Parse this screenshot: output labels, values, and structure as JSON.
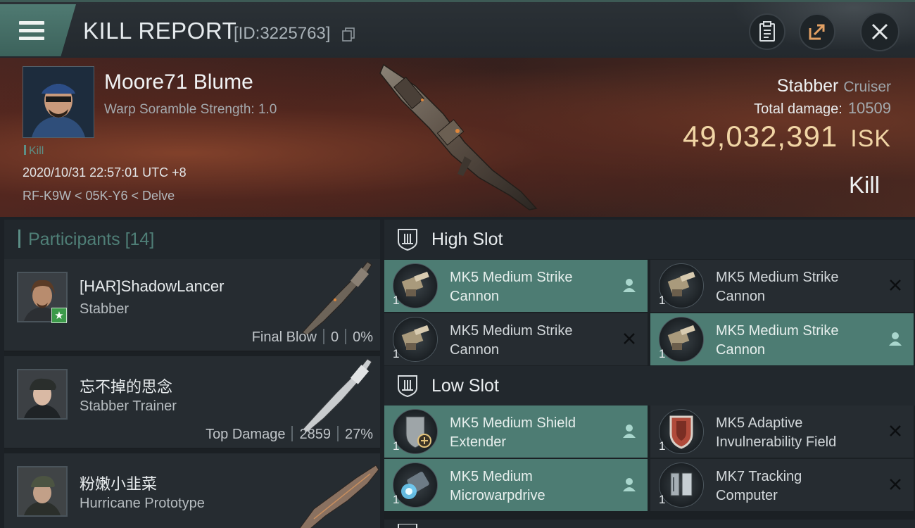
{
  "header": {
    "title": "KILL REPORT",
    "report_id": "[ID:3225763]",
    "icons": [
      "menu-icon",
      "copy-icon",
      "clipboard-icon",
      "share-icon",
      "close-icon"
    ]
  },
  "victim": {
    "name": "Moore71 Blume",
    "warp_scramble": "Warp Soramble Strength: 1.0",
    "tag": "Kill",
    "datetime": "2020/10/31 22:57:01 UTC +8",
    "location": "RF-K9W < 05K-Y6 < Delve",
    "ship": "Stabber",
    "ship_class": "Cruiser",
    "total_damage_label": "Total damage:",
    "total_damage": "10509",
    "isk_value": "49,032,391",
    "isk_unit": "ISK",
    "result": "Kill"
  },
  "participants": {
    "title": "Participants",
    "count": "[14]",
    "rows": [
      {
        "name": "[HAR]ShadowLancer",
        "ship": "Stabber",
        "stat_label": "Final Blow",
        "damage": "0",
        "percent": "0%"
      },
      {
        "name": "忘不掉的思念",
        "ship": "Stabber Trainer",
        "stat_label": "Top Damage",
        "damage": "2859",
        "percent": "27%"
      },
      {
        "name": "粉嫩小韭菜",
        "ship": "Hurricane Prototype",
        "stat_label": "",
        "damage": "",
        "percent": ""
      }
    ]
  },
  "slots": {
    "high": {
      "label": "High Slot",
      "modules": [
        {
          "qty": "1",
          "line1": "MK5 Medium Strike",
          "line2": "Cannon",
          "status": "dropped"
        },
        {
          "qty": "1",
          "line1": "MK5 Medium Strike",
          "line2": "Cannon",
          "status": "destroyed"
        },
        {
          "qty": "1",
          "line1": "MK5 Medium Strike",
          "line2": "Cannon",
          "status": "destroyed"
        },
        {
          "qty": "1",
          "line1": "MK5 Medium Strike",
          "line2": "Cannon",
          "status": "dropped"
        }
      ]
    },
    "low": {
      "label": "Low Slot",
      "modules": [
        {
          "qty": "1",
          "line1": "MK5 Medium Shield",
          "line2": "Extender",
          "status": "dropped"
        },
        {
          "qty": "1",
          "line1": "MK5 Adaptive",
          "line2": "Invulnerability Field",
          "status": "destroyed"
        },
        {
          "qty": "1",
          "line1": "MK5 Medium",
          "line2": "Microwarpdrive",
          "status": "dropped"
        },
        {
          "qty": "1",
          "line1": "MK7 Tracking",
          "line2": "Computer",
          "status": "destroyed"
        }
      ]
    }
  },
  "colors": {
    "accent": "#4d7c73",
    "isk": "#f1d5a5",
    "panel": "#262c31"
  }
}
